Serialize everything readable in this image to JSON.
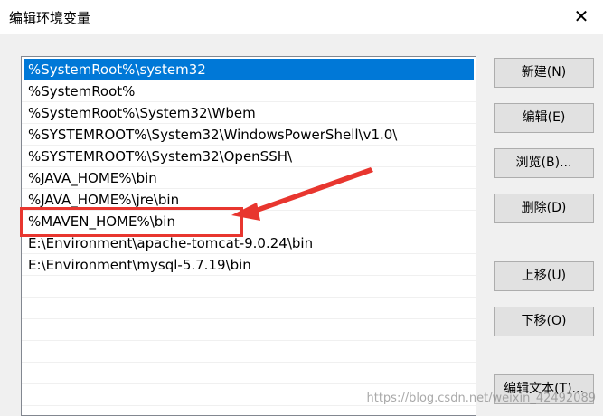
{
  "window": {
    "title": "编辑环境变量",
    "close_symbol": "✕"
  },
  "list": {
    "items": [
      {
        "text": "%SystemRoot%\\system32",
        "selected": true
      },
      {
        "text": "%SystemRoot%",
        "selected": false
      },
      {
        "text": "%SystemRoot%\\System32\\Wbem",
        "selected": false
      },
      {
        "text": "%SYSTEMROOT%\\System32\\WindowsPowerShell\\v1.0\\",
        "selected": false
      },
      {
        "text": "%SYSTEMROOT%\\System32\\OpenSSH\\",
        "selected": false
      },
      {
        "text": "%JAVA_HOME%\\bin",
        "selected": false
      },
      {
        "text": "%JAVA_HOME%\\jre\\bin",
        "selected": false
      },
      {
        "text": "%MAVEN_HOME%\\bin",
        "selected": false
      },
      {
        "text": "E:\\Environment\\apache-tomcat-9.0.24\\bin",
        "selected": false
      },
      {
        "text": "E:\\Environment\\mysql-5.7.19\\bin",
        "selected": false
      }
    ]
  },
  "buttons": {
    "new": "新建(N)",
    "edit": "编辑(E)",
    "browse": "浏览(B)...",
    "delete": "删除(D)",
    "move_up": "上移(U)",
    "move_down": "下移(O)",
    "edit_text": "编辑文本(T)..."
  },
  "watermark": "https://blog.csdn.net/weixin_42492089",
  "colors": {
    "selection": "#0078d7",
    "annotation": "#e8362f"
  }
}
